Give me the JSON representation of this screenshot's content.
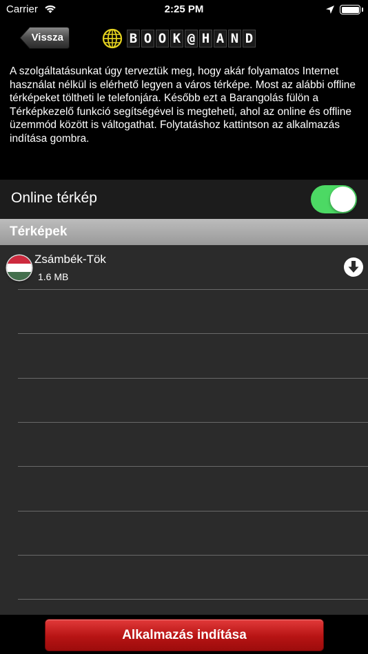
{
  "status_bar": {
    "carrier": "Carrier",
    "time": "2:25 PM",
    "icons": [
      "wifi-icon",
      "location-arrow-icon",
      "battery-icon"
    ]
  },
  "navbar": {
    "back_label": "Vissza",
    "logo_icon": "globe-icon",
    "logo_letters": [
      "B",
      "O",
      "O",
      "K",
      "@",
      "H",
      "A",
      "N",
      "D"
    ]
  },
  "intro": {
    "text": "A szolgáltatásunkat úgy terveztük meg, hogy akár folyamatos Internet használat nélkül is elérhető legyen a város térképe. Most az alábbi offline térképeket töltheti le telefonjára. Később ezt a Barangolás fülön a Térképkezelő funkció segítségével is megteheti, ahol az online és offline üzemmód között is váltogathat. Folytatáshoz kattintson az alkalmazás indítása gombra."
  },
  "online_map": {
    "label": "Online térkép",
    "enabled": true,
    "switch_color": "#4cd964"
  },
  "maps_section": {
    "title": "Térképek",
    "items": [
      {
        "name": "Zsámbék-Tök",
        "size": "1.6 MB",
        "flag_icon": "hungary-flag-icon",
        "flag_colors": [
          "#cd2a3e",
          "#ffffff",
          "#436f4d"
        ],
        "action_icon": "download-icon"
      }
    ]
  },
  "launch_button": {
    "label": "Alkalmazás indítása",
    "color": "#c41e1e"
  }
}
